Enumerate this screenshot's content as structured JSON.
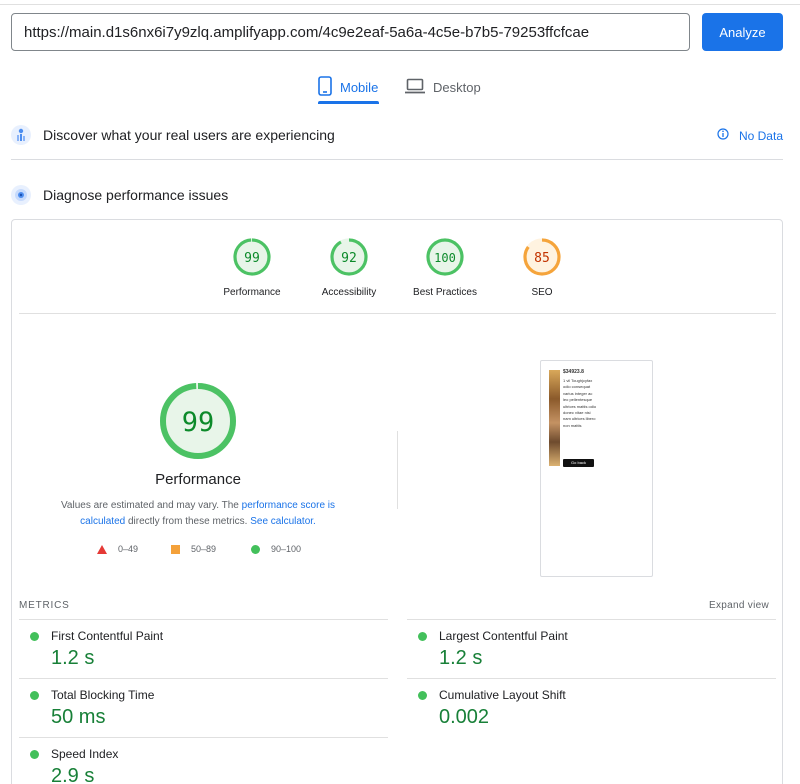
{
  "search": {
    "url_value": "https://main.d1s6nx6i7y9zlq.amplifyapp.com/4c9e2eaf-5a6a-4c5e-b7b5-79253ffcfcae",
    "analyze_label": "Analyze"
  },
  "tabs": [
    {
      "label": "Mobile",
      "icon": "smartphone-icon",
      "active": true
    },
    {
      "label": "Desktop",
      "icon": "laptop-icon",
      "active": false
    }
  ],
  "field_data": {
    "title": "Discover what your real users are experiencing",
    "status": "No Data",
    "status_icon": "info-icon"
  },
  "lab_data": {
    "title": "Diagnose performance issues"
  },
  "scores": [
    {
      "label": "Performance",
      "value": "99",
      "color": "#0c8a2a",
      "fill": "#e8f5e9",
      "ring": "#4cc264",
      "fraction": 0.99
    },
    {
      "label": "Accessibility",
      "value": "92",
      "color": "#0c8a2a",
      "fill": "#e8f5e9",
      "ring": "#4cc264",
      "fraction": 0.92
    },
    {
      "label": "Best Practices",
      "value": "100",
      "color": "#0c8a2a",
      "fill": "#e8f5e9",
      "ring": "#4cc264",
      "fraction": 1.0
    },
    {
      "label": "SEO",
      "value": "85",
      "color": "#c33300",
      "fill": "#fff3e0",
      "ring": "#f5a43b",
      "fraction": 0.85
    }
  ],
  "performance": {
    "score": "99",
    "fraction": 0.99,
    "title": "Performance",
    "desc_prefix": "Values are estimated and may vary. The ",
    "desc_link1": "performance score is calculated",
    "desc_middle": " directly from these metrics. ",
    "desc_link2": "See calculator.",
    "legend": [
      {
        "shape": "triangle",
        "range": "0–49",
        "color": "#e53935"
      },
      {
        "shape": "square",
        "range": "50–89",
        "color": "#f4a13a"
      },
      {
        "shape": "circle",
        "range": "90–100",
        "color": "#43c05b"
      }
    ]
  },
  "screenshot": {
    "price": "$34923.8",
    "text": "1 vil Toughjcyfax odio consequat varius integer ac leo pellentesque ultrices mattis odio donec vitae nisi nam ultrices libero non mattis",
    "button": "Go back"
  },
  "metrics": {
    "label": "METRICS",
    "expand_label": "Expand view",
    "items": [
      {
        "name": "First Contentful Paint",
        "value": "1.2 s"
      },
      {
        "name": "Largest Contentful Paint",
        "value": "1.2 s"
      },
      {
        "name": "Total Blocking Time",
        "value": "50 ms"
      },
      {
        "name": "Cumulative Layout Shift",
        "value": "0.002"
      },
      {
        "name": "Speed Index",
        "value": "2.9 s"
      }
    ]
  },
  "colors": {
    "accent": "#1a73e8",
    "pass": "#43c05b",
    "average": "#f4a13a",
    "fail": "#e53935"
  }
}
